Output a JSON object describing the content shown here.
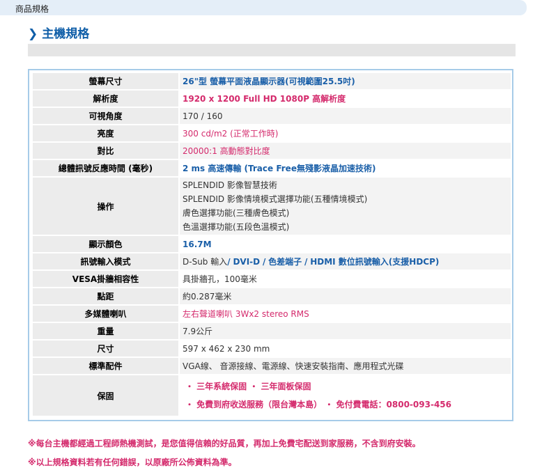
{
  "header": {
    "breadcrumb": "商品規格"
  },
  "section": {
    "chevron": "❯",
    "title": "主機規格"
  },
  "specs": {
    "screen_size": {
      "label": "螢幕尺寸",
      "value": "26\"型 螢幕平面液晶顯示器(可視範圍25.5吋)"
    },
    "resolution": {
      "label": "解析度",
      "value": "1920 x 1200 Full HD 1080P 高解析度"
    },
    "viewing_angle": {
      "label": "可視角度",
      "value": "170 / 160"
    },
    "brightness": {
      "label": "亮度",
      "value": "300 cd/m2 (正常工作時)"
    },
    "contrast": {
      "label": "對比",
      "value": "20000:1 高動態對比度"
    },
    "response_time": {
      "label": "總體訊號反應時間 (毫秒)",
      "value": "2 ms 高速傳輸 (Trace Free無殘影液晶加速技術)"
    },
    "operation": {
      "label": "操作",
      "line1": "SPLENDID 影像智慧技術",
      "line2": "SPLENDID 影像情境模式選擇功能(五種情境模式)",
      "line3": "膚色選擇功能(三種膚色模式)",
      "line4": "色溫選擇功能(五段色溫模式)"
    },
    "colors": {
      "label": "顯示顏色",
      "value": "16.7M"
    },
    "input": {
      "label": "訊號輸入模式",
      "part1": "D-Sub 輸入",
      "sep1": "/",
      "part2": "DVI-D",
      "sep2": "/",
      "part3": "色差端子",
      "sep3": "/",
      "part4": "HDMI 數位訊號輸入(支援HDCP)"
    },
    "vesa": {
      "label": "VESA掛牆相容性",
      "value": "具掛牆孔，100毫米"
    },
    "dot_pitch": {
      "label": "點距",
      "value": "約0.287毫米"
    },
    "speakers": {
      "label": "多媒體喇叭",
      "value": "左右聲道喇叭 3Wx2 stereo RMS"
    },
    "weight": {
      "label": "重量",
      "value": "7.9公斤"
    },
    "dimensions": {
      "label": "尺寸",
      "value": "597 x 462 x 230 mm"
    },
    "accessories": {
      "label": "標準配件",
      "value": "VGA線、 音源接線、電源線、快速安裝指南、應用程式光碟"
    },
    "warranty": {
      "label": "保固",
      "line1": "・ 三年系統保固 ・ 三年面板保固",
      "line2": "・ 免費到府收送服務（限台灣本島） ・ 免付費電話：0800-093-456"
    }
  },
  "notes": {
    "note1": "※每台主機都經過工程師熱機測試，是您值得信賴的好品質，再加上免費宅配送到家服務，不含到府安裝。",
    "note2": "※以上規格資料若有任何錯誤，以原廠所公佈資料為準。"
  },
  "colors": {
    "accent_blue": "#1a5fa8",
    "accent_pink": "#d42a6c",
    "frame": "#a6cbe8"
  }
}
